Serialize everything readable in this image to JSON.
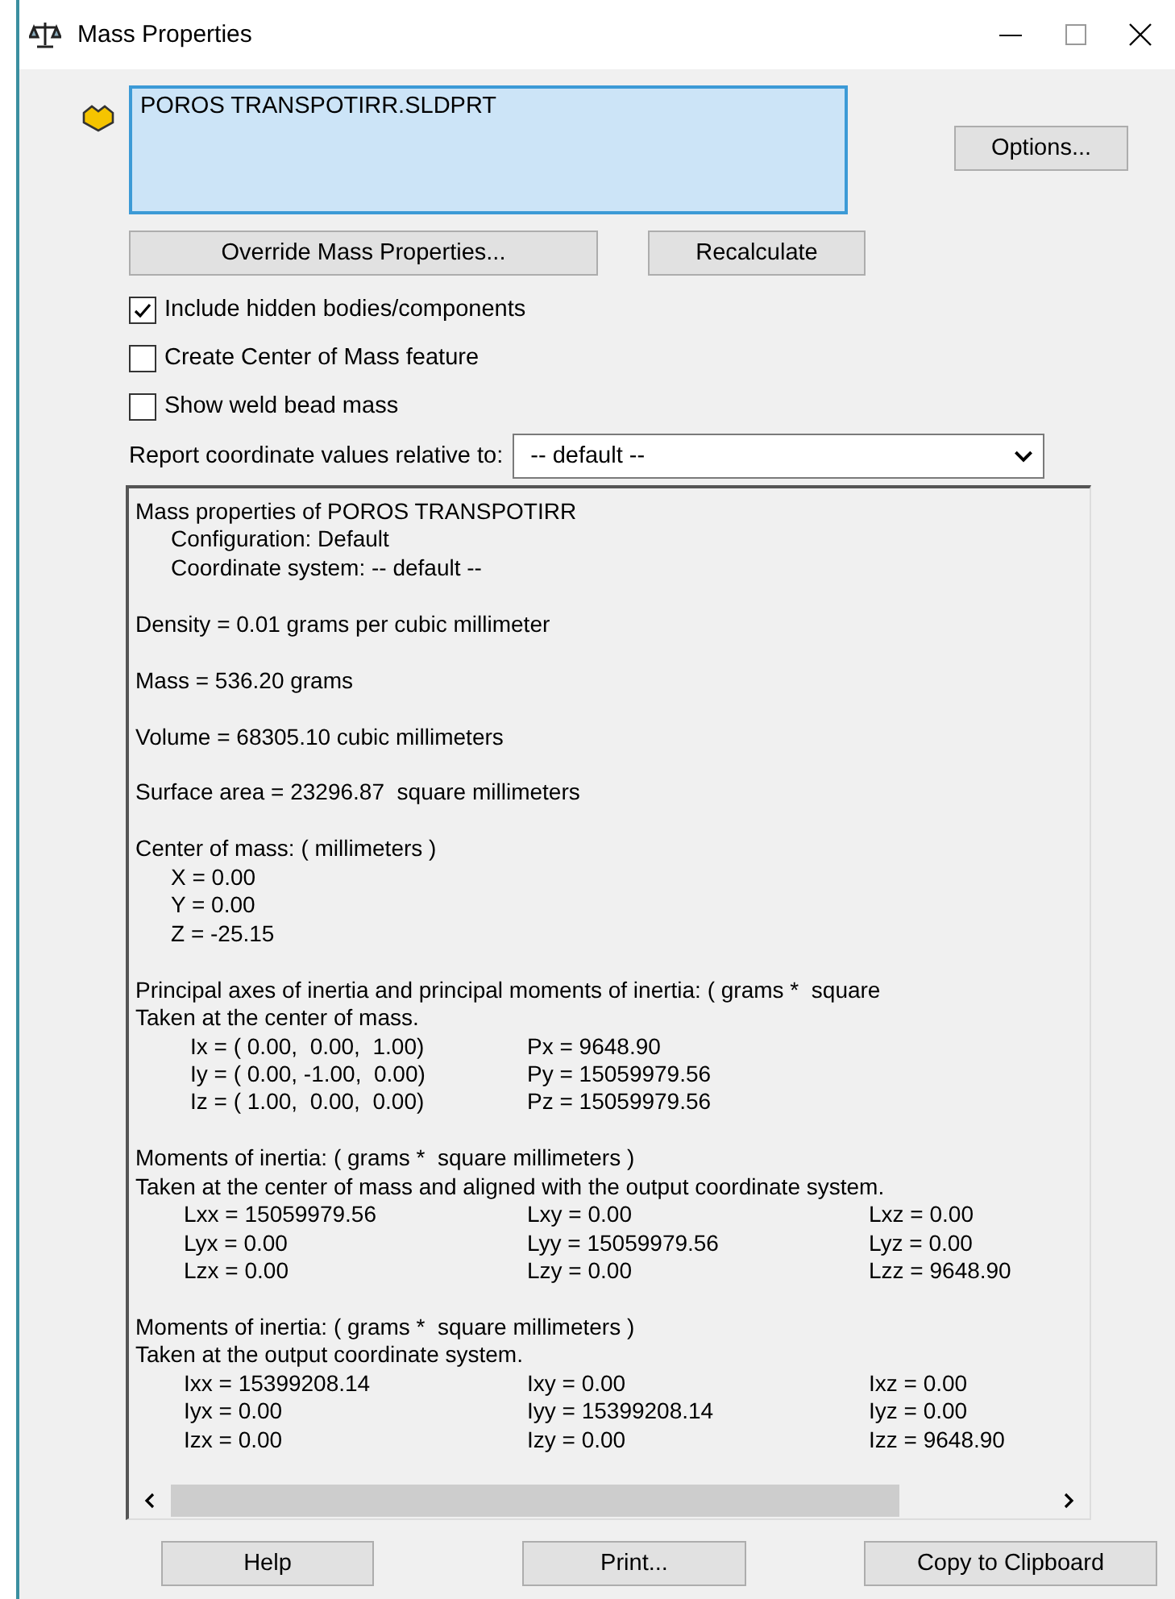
{
  "window": {
    "title": "Mass Properties"
  },
  "selection_list": {
    "items": [
      "POROS TRANSPOTIRR.SLDPRT"
    ]
  },
  "buttons_top": {
    "options": "Options...",
    "override": "Override Mass Properties...",
    "recalculate": "Recalculate"
  },
  "checkboxes": [
    {
      "label": "Include hidden bodies/components",
      "checked": true
    },
    {
      "label": "Create Center of Mass feature",
      "checked": false
    },
    {
      "label": "Show weld bead mass",
      "checked": false
    }
  ],
  "coordinate_select": {
    "label": "Report coordinate values relative to:",
    "value": "-- default --"
  },
  "results": {
    "sections": [
      {
        "lines": [
          {
            "kind": "line",
            "text": "Mass properties of POROS TRANSPOTIRR"
          },
          {
            "kind": "sub",
            "text": "Configuration: Default"
          },
          {
            "kind": "sub",
            "text": "Coordinate system: -- default --"
          }
        ]
      },
      {
        "lines": [
          {
            "kind": "line",
            "text": "Density = 0.01 grams per cubic millimeter"
          }
        ]
      },
      {
        "lines": [
          {
            "kind": "line",
            "text": "Mass = 536.20 grams"
          }
        ]
      },
      {
        "lines": [
          {
            "kind": "line",
            "text": "Volume = 68305.10 cubic millimeters"
          }
        ]
      },
      {
        "lines": [
          {
            "kind": "line",
            "text": "Surface area = 23296.87  square millimeters"
          }
        ]
      },
      {
        "lines": [
          {
            "kind": "line",
            "text": "Center of mass: ( millimeters )"
          },
          {
            "kind": "sub",
            "text": "X = 0.00"
          },
          {
            "kind": "sub",
            "text": "Y = 0.00"
          },
          {
            "kind": "sub",
            "text": "Z = -25.15"
          }
        ]
      },
      {
        "lines": [
          {
            "kind": "line",
            "text": "Principal axes of inertia and principal moments of inertia: ( grams *  square"
          },
          {
            "kind": "line",
            "text": "Taken at the center of mass."
          },
          {
            "kind": "row",
            "cells": [
              "Ix = ( 0.00,  0.00,  1.00)",
              "Px = 9648.90"
            ]
          },
          {
            "kind": "row",
            "cells": [
              "Iy = ( 0.00, -1.00,  0.00)",
              "Py = 15059979.56"
            ]
          },
          {
            "kind": "row",
            "cells": [
              "Iz = ( 1.00,  0.00,  0.00)",
              "Pz = 15059979.56"
            ]
          }
        ]
      },
      {
        "lines": [
          {
            "kind": "line",
            "text": "Moments of inertia: ( grams *  square millimeters )"
          },
          {
            "kind": "line",
            "text": "Taken at the center of mass and aligned with the output coordinate system."
          },
          {
            "kind": "row",
            "cells": [
              "Lxx = 15059979.56",
              "Lxy = 0.00",
              "Lxz = 0.00"
            ]
          },
          {
            "kind": "row",
            "cells": [
              "Lyx = 0.00",
              "Lyy = 15059979.56",
              "Lyz = 0.00"
            ]
          },
          {
            "kind": "row",
            "cells": [
              "Lzx = 0.00",
              "Lzy = 0.00",
              "Lzz = 9648.90"
            ]
          }
        ]
      },
      {
        "lines": [
          {
            "kind": "line",
            "text": "Moments of inertia: ( grams *  square millimeters )"
          },
          {
            "kind": "line",
            "text": "Taken at the output coordinate system."
          },
          {
            "kind": "row",
            "cells": [
              "Ixx = 15399208.14",
              "Ixy = 0.00",
              "Ixz = 0.00"
            ]
          },
          {
            "kind": "row",
            "cells": [
              "Iyx = 0.00",
              "Iyy = 15399208.14",
              "Iyz = 0.00"
            ]
          },
          {
            "kind": "row",
            "cells": [
              "Izx = 0.00",
              "Izy = 0.00",
              "Izz = 9648.90"
            ]
          }
        ]
      }
    ]
  },
  "buttons_bottom": [
    "Help",
    "Print...",
    "Copy to Clipboard"
  ]
}
